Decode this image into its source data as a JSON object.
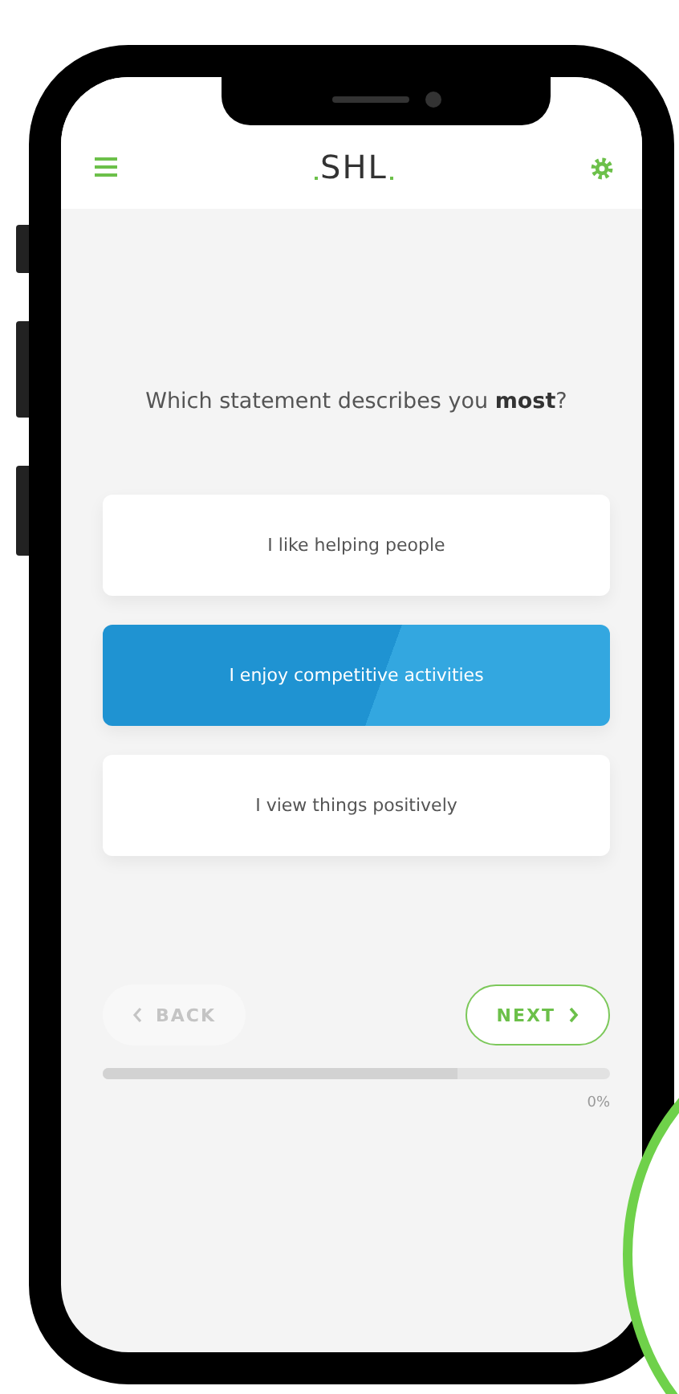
{
  "header": {
    "logo": "SHL"
  },
  "question": "Which statement describes you **most**?",
  "options": [
    {
      "label": "I like helping people",
      "selected": false
    },
    {
      "label": "I enjoy competitive activities",
      "selected": true
    },
    {
      "label": "I view things positively",
      "selected": false
    }
  ],
  "back_button": {
    "label": "BACK",
    "disabled": true
  },
  "next_button": {
    "label": "NEXT",
    "disabled": false
  },
  "progress": {
    "level": 0.7,
    "reading": "0%"
  }
}
